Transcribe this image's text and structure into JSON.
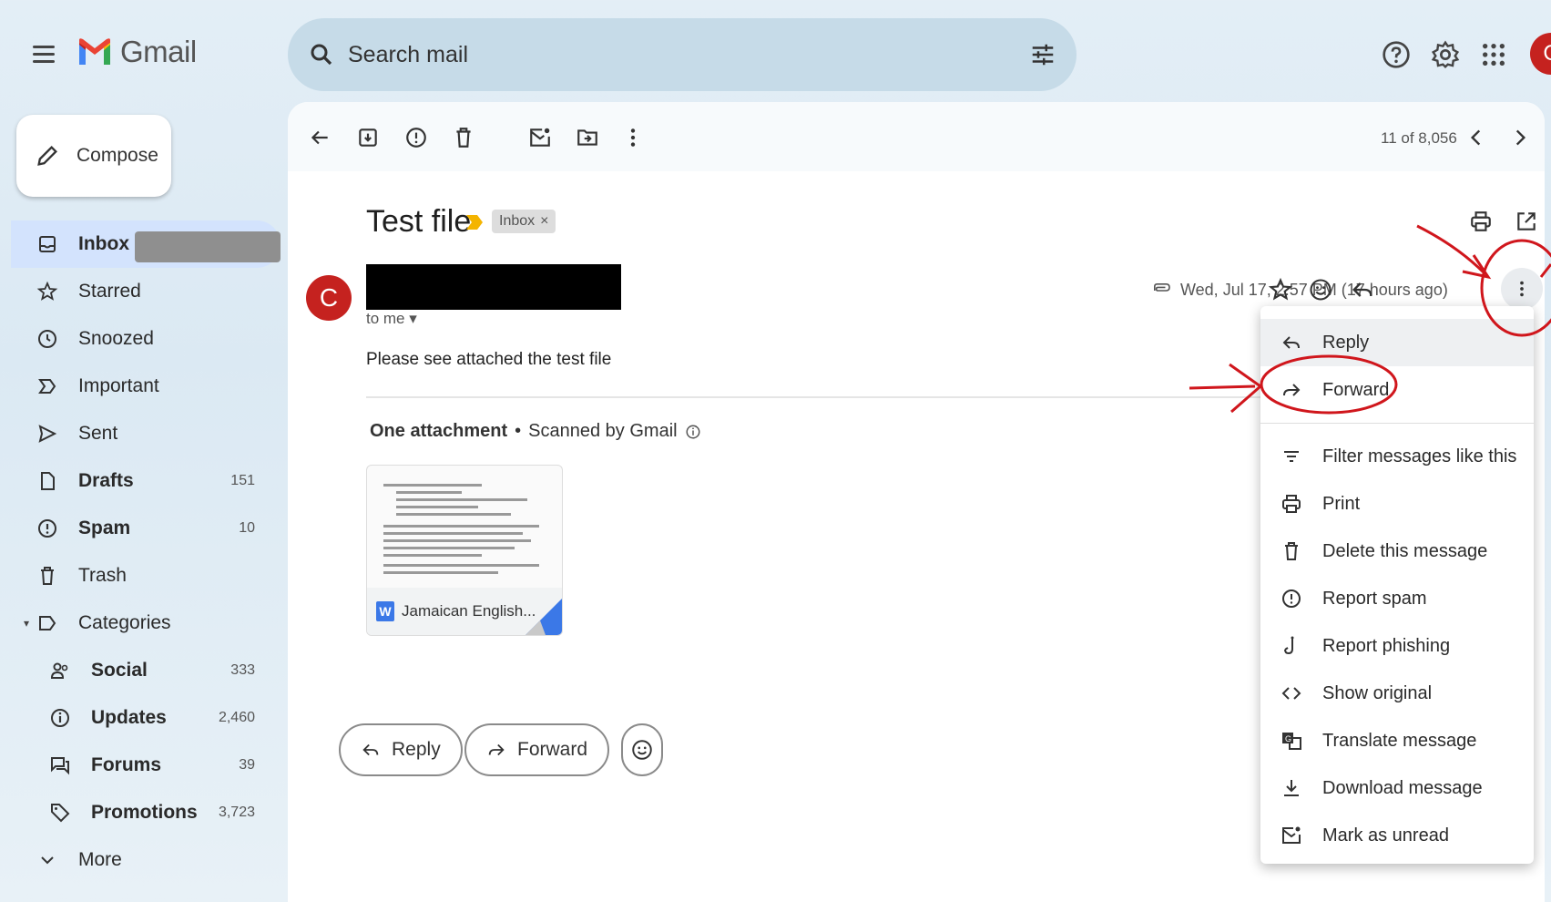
{
  "app": {
    "name": "Gmail"
  },
  "search": {
    "placeholder": "Search mail"
  },
  "account": {
    "initial": "C"
  },
  "compose": {
    "label": "Compose"
  },
  "sidebar": {
    "items": [
      {
        "label": "Inbox",
        "count": ""
      },
      {
        "label": "Starred",
        "count": ""
      },
      {
        "label": "Snoozed",
        "count": ""
      },
      {
        "label": "Important",
        "count": ""
      },
      {
        "label": "Sent",
        "count": ""
      },
      {
        "label": "Drafts",
        "count": "151"
      },
      {
        "label": "Spam",
        "count": "10"
      },
      {
        "label": "Trash",
        "count": ""
      },
      {
        "label": "Categories",
        "count": ""
      },
      {
        "label": "Social",
        "count": "333"
      },
      {
        "label": "Updates",
        "count": "2,460"
      },
      {
        "label": "Forums",
        "count": "39"
      },
      {
        "label": "Promotions",
        "count": "3,723"
      },
      {
        "label": "More",
        "count": ""
      }
    ]
  },
  "toolbar": {
    "pager": "11 of 8,056"
  },
  "message": {
    "subject": "Test file",
    "label": "Inbox",
    "sender_initial": "C",
    "to": "to me",
    "timestamp": "Wed, Jul 17, 2:57 PM (17 hours ago)",
    "body": "Please see attached the test file",
    "attachment_header": "One attachment",
    "scanned": "Scanned by Gmail",
    "attachment_name": "Jamaican English...",
    "attachment_badge": "W"
  },
  "actions": {
    "reply": "Reply",
    "forward": "Forward"
  },
  "menu": {
    "items": [
      {
        "label": "Reply",
        "icon": "reply-icon"
      },
      {
        "label": "Forward",
        "icon": "forward-icon"
      },
      {
        "label": "Filter messages like this",
        "icon": "filter-icon"
      },
      {
        "label": "Print",
        "icon": "print-icon"
      },
      {
        "label": "Delete this message",
        "icon": "trash-icon"
      },
      {
        "label": "Report spam",
        "icon": "spam-icon"
      },
      {
        "label": "Report phishing",
        "icon": "phishing-icon"
      },
      {
        "label": "Show original",
        "icon": "code-icon"
      },
      {
        "label": "Translate message",
        "icon": "translate-icon"
      },
      {
        "label": "Download message",
        "icon": "download-icon"
      },
      {
        "label": "Mark as unread",
        "icon": "mark-unread-icon"
      }
    ]
  },
  "colors": {
    "accent": "#c5221f",
    "annotation": "#d0161c",
    "active_nav": "#d3e3fd"
  }
}
